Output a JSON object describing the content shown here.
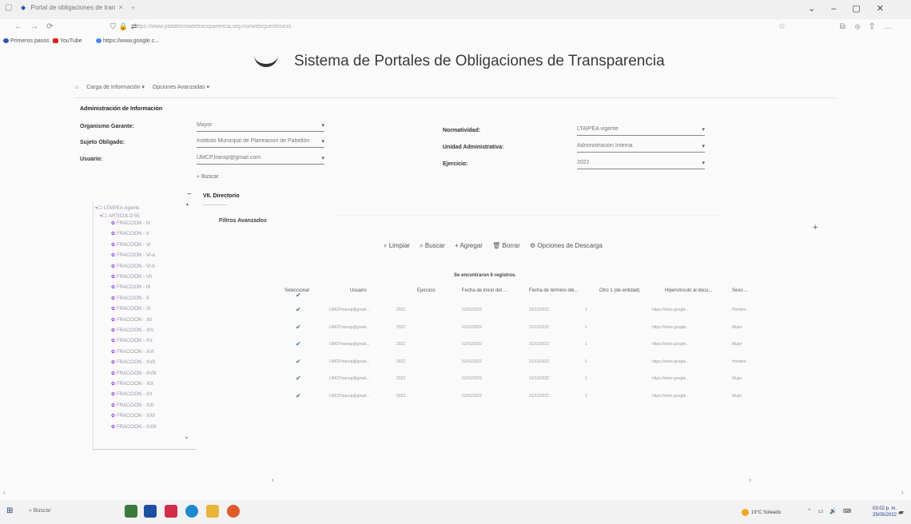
{
  "browser": {
    "tab_title": "Portal de obligaciones de tran",
    "url": "https://www.plataformadetransparencia.org.mx/web/guest/inicio",
    "bookmarks": [
      "Primeros pasos",
      "YouTube",
      "https://www.google.c..."
    ]
  },
  "site": {
    "title": "Sistema de Portales de Obligaciones de Transparencia",
    "menu": [
      "Carga de Información ▾",
      "Opciones Avanzadas ▾"
    ]
  },
  "form": {
    "section_title": "Administración de Información",
    "fields": [
      {
        "label": "Organismo Garante:",
        "value": "Mayor"
      },
      {
        "label": "Sujeto Obligado:",
        "value": "Instituto Municipal de Planeación de Pabellón"
      },
      {
        "label": "Usuario:",
        "value": "UMCP.transp@gmail.com"
      },
      {
        "label": "Normatividad:",
        "value": "LTAIPEA vigente"
      },
      {
        "label": "Unidad Administrativa:",
        "value": "Administración Interna"
      },
      {
        "label": "Ejercicio:",
        "value": "2022"
      }
    ],
    "search_link": "⌕ Buscar"
  },
  "tree": {
    "root": "LTAIPEA vigente",
    "article": "ARTICULO 55",
    "fractions": [
      "FRACCION - IV",
      "FRACCION - V",
      "FRACCION - VI",
      "FRACCION - VI-a",
      "FRACCION - VI-b",
      "FRACCION - VII",
      "FRACCION - IX",
      "FRACCION - X",
      "FRACCION - XI",
      "FRACCION - XII",
      "FRACCION - XIV",
      "FRACCION - XV",
      "FRACCION - XVI",
      "FRACCION - XVII",
      "FRACCION - XVIII",
      "FRACCION - XIX",
      "FRACCION - XX",
      "FRACCION - XXI",
      "FRACCION - XXII",
      "FRACCION - XXIII"
    ]
  },
  "panel": {
    "title": "VII. Directorio",
    "filters": "Filtros Avanzados",
    "actions": [
      "⌕ Limpiar",
      "⌕ Buscar",
      "+ Agregar",
      "🗑 Borrar",
      "⚙ Opciones de Descarga"
    ],
    "records_text": "Se encontraron 6 registros."
  },
  "grid": {
    "headers": [
      "Seleccionar",
      "Usuario",
      "Ejercicio",
      "Fecha de inicio del ...",
      "Fecha de término del...",
      "Otro 1 (de entidad)",
      "Hipervínculo al docu...",
      "Sexo ..."
    ],
    "rows": [
      [
        "UMCP.transp@gmail...",
        "2022",
        "01/01/2022",
        "31/12/2022",
        "1",
        "https://drive.google...",
        "Hombre"
      ],
      [
        "UMCP.transp@gmail...",
        "2022",
        "01/01/2022",
        "31/12/2022",
        "1",
        "https://drive.google...",
        "Mujer"
      ],
      [
        "UMCP.transp@gmail...",
        "2022",
        "01/01/2022",
        "31/12/2022",
        "1",
        "https://drive.google...",
        "Mujer"
      ],
      [
        "UMCP.transp@gmail...",
        "2022",
        "01/01/2022",
        "31/12/2022",
        "1",
        "https://drive.google...",
        "Hombre"
      ],
      [
        "UMCP.transp@gmail...",
        "2022",
        "01/01/2022",
        "31/12/2022",
        "1",
        "https://drive.google...",
        "Mujer"
      ],
      [
        "UMCP.transp@gmail...",
        "2022",
        "01/01/2022",
        "31/12/2022",
        "1",
        "https://drive.google...",
        "Mujer"
      ]
    ]
  },
  "taskbar": {
    "search": "Buscar",
    "weather": "19°C Soleado",
    "time": "03:02 p. m.",
    "date": "25/05/2022"
  }
}
